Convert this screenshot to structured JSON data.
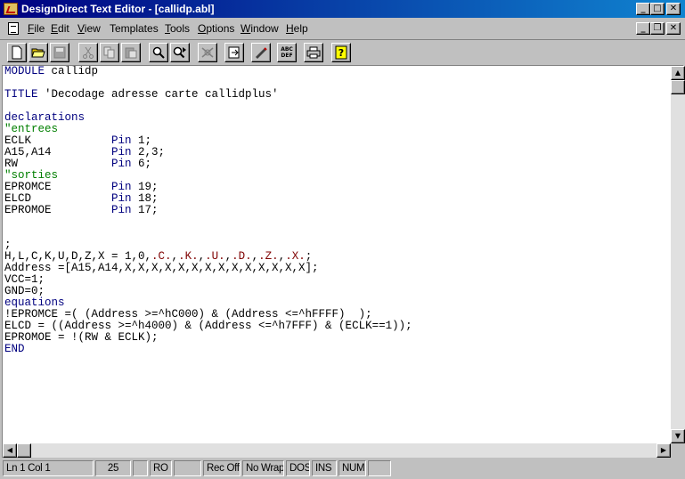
{
  "window": {
    "title": "DesignDirect Text Editor - [callidp.abl]",
    "min_glyph": "_",
    "max_glyph": "□",
    "close_glyph": "✕",
    "doc_min_glyph": "_",
    "doc_restore_glyph": "❐",
    "doc_close_glyph": "✕"
  },
  "menu": [
    {
      "label": "File",
      "key": "F",
      "rest": "ile"
    },
    {
      "label": "Edit",
      "key": "E",
      "rest": "dit"
    },
    {
      "label": "View",
      "key": "V",
      "rest": "iew"
    },
    {
      "label": "Templates",
      "key": "",
      "rest": "Templates"
    },
    {
      "label": "Tools",
      "key": "T",
      "rest": "ools"
    },
    {
      "label": "Options",
      "key": "O",
      "rest": "ptions"
    },
    {
      "label": "Window",
      "key": "W",
      "rest": "indow"
    },
    {
      "label": "Help",
      "key": "H",
      "rest": "elp"
    }
  ],
  "toolbar": {
    "icons": [
      "new-file-icon",
      "open-folder-icon",
      "save-disk-icon",
      "cut-scissors-icon",
      "copy-icon",
      "paste-icon",
      "find-icon",
      "find-next-icon",
      "replace-icon",
      "goto-line-icon",
      "syntax-check-icon",
      "abc-convert-icon",
      "print-icon",
      "help-icon"
    ],
    "abc_top": "ABC",
    "abc_bottom": "DEF"
  },
  "code": [
    [
      {
        "t": "MODULE",
        "c": "kw"
      },
      {
        "t": " callidp",
        "c": ""
      }
    ],
    [],
    [
      {
        "t": "TITLE",
        "c": "kw"
      },
      {
        "t": " 'Decodage adresse carte callidplus'",
        "c": ""
      }
    ],
    [],
    [
      {
        "t": "declarations",
        "c": "kw"
      }
    ],
    [
      {
        "t": "\"entrees",
        "c": "cm"
      }
    ],
    [
      {
        "t": "ECLK            ",
        "c": ""
      },
      {
        "t": "Pin",
        "c": "kw"
      },
      {
        "t": " 1;",
        "c": ""
      }
    ],
    [
      {
        "t": "A15,A14         ",
        "c": ""
      },
      {
        "t": "Pin",
        "c": "kw"
      },
      {
        "t": " 2,3;",
        "c": ""
      }
    ],
    [
      {
        "t": "RW              ",
        "c": ""
      },
      {
        "t": "Pin",
        "c": "kw"
      },
      {
        "t": " 6;",
        "c": ""
      }
    ],
    [
      {
        "t": "\"sorties",
        "c": "cm"
      }
    ],
    [
      {
        "t": "EPROMCE         ",
        "c": ""
      },
      {
        "t": "Pin",
        "c": "kw"
      },
      {
        "t": " 19;",
        "c": ""
      }
    ],
    [
      {
        "t": "ELCD            ",
        "c": ""
      },
      {
        "t": "Pin",
        "c": "kw"
      },
      {
        "t": " 18;",
        "c": ""
      }
    ],
    [
      {
        "t": "EPROMOE         ",
        "c": ""
      },
      {
        "t": "Pin",
        "c": "kw"
      },
      {
        "t": " 17;",
        "c": ""
      }
    ],
    [],
    [],
    [
      {
        "t": ";",
        "c": ""
      }
    ],
    [
      {
        "t": "H,L,C,K,U,D,Z,X = 1,0,",
        "c": ""
      },
      {
        "t": ".C.",
        "c": "mg"
      },
      {
        "t": ",",
        "c": ""
      },
      {
        "t": ".K.",
        "c": "mg"
      },
      {
        "t": ",",
        "c": ""
      },
      {
        "t": ".U.",
        "c": "mg"
      },
      {
        "t": ",",
        "c": ""
      },
      {
        "t": ".D.",
        "c": "mg"
      },
      {
        "t": ",",
        "c": ""
      },
      {
        "t": ".Z.",
        "c": "mg"
      },
      {
        "t": ",",
        "c": ""
      },
      {
        "t": ".X.",
        "c": "mg"
      },
      {
        "t": ";",
        "c": ""
      }
    ],
    [
      {
        "t": "Address =[A15,A14,X,X,X,X,X,X,X,X,X,X,X,X,X,X];",
        "c": ""
      }
    ],
    [
      {
        "t": "VCC=1;",
        "c": ""
      }
    ],
    [
      {
        "t": "GND=0;",
        "c": ""
      }
    ],
    [
      {
        "t": "equations",
        "c": "kw"
      }
    ],
    [
      {
        "t": "!EPROMCE =( (Address >=^hC000) & (Address <=^hFFFF)  );",
        "c": ""
      }
    ],
    [
      {
        "t": "ELCD = ((Address >=^h4000) & (Address <=^h7FFF) & (ECLK==1));",
        "c": ""
      }
    ],
    [
      {
        "t": "EPROMOE = !(RW & ECLK);",
        "c": ""
      }
    ],
    [
      {
        "t": "END",
        "c": "kw"
      }
    ]
  ],
  "scroll": {
    "up": "▲",
    "down": "▼",
    "left": "◀",
    "right": "▶"
  },
  "status": {
    "position": "Ln 1 Col 1",
    "value": "25",
    "blank1": "",
    "ro": "RO",
    "blank2": "",
    "rec": "Rec Off",
    "wrap": "No Wrap",
    "dos": "DOS",
    "ins": "INS",
    "num": "NUM",
    "blank3": ""
  }
}
